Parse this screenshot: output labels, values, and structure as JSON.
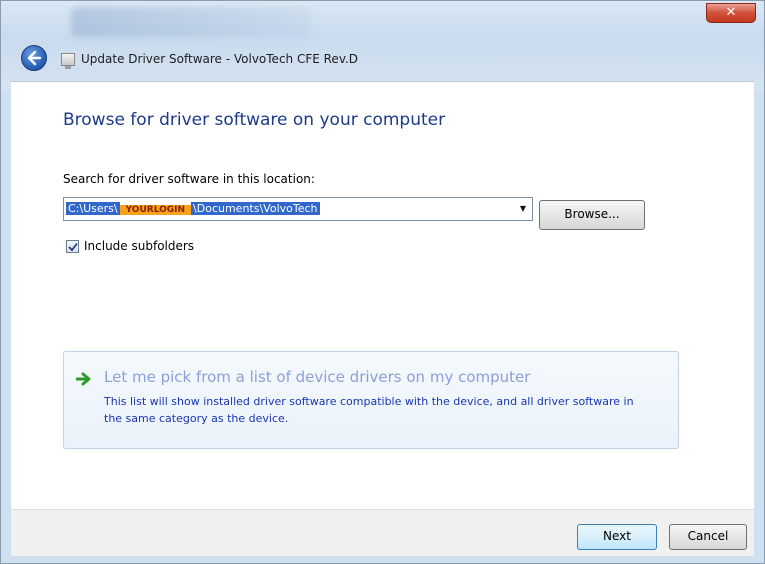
{
  "window": {
    "title": "Update Driver Software - VolvoTech CFE Rev.D",
    "close_glyph": "✕"
  },
  "main": {
    "heading": "Browse for driver software on your computer",
    "search_label": "Search for driver software in this location:",
    "path": {
      "prefix": "C:\\Users\\",
      "user": "YOURLOGIN",
      "suffix": "\\Documents\\VolvoTech"
    },
    "browse_label": "Browse...",
    "include_subfolders": {
      "label": "Include subfolders",
      "checked": true
    },
    "pick_option": {
      "title": "Let me pick from a list of device drivers on my computer",
      "description": "This list will show installed driver software compatible with the device, and all driver software in the same category as the device."
    }
  },
  "footer": {
    "next_label": "Next",
    "cancel_label": "Cancel"
  },
  "colors": {
    "heading": "#1b3a8a",
    "link": "#1b36b0",
    "selection": "#3168c9",
    "highlight": "#f7a21a",
    "pick_arrow": "#2e9a2e"
  },
  "icons": [
    "back-arrow-icon",
    "driver-device-icon",
    "close-icon",
    "dropdown-arrow-icon",
    "check-icon",
    "green-arrow-icon"
  ]
}
